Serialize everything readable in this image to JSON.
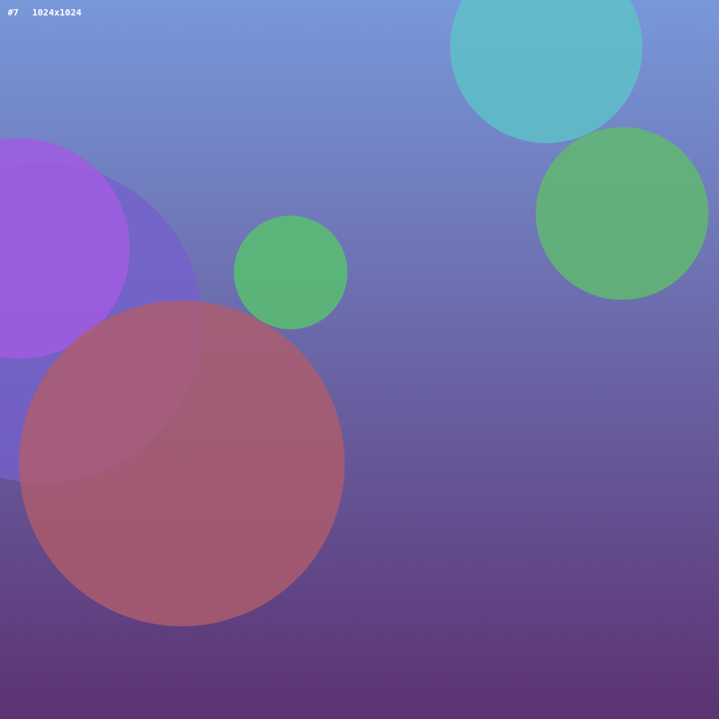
{
  "caption": {
    "number": "#7",
    "size": "1024x1024"
  }
}
